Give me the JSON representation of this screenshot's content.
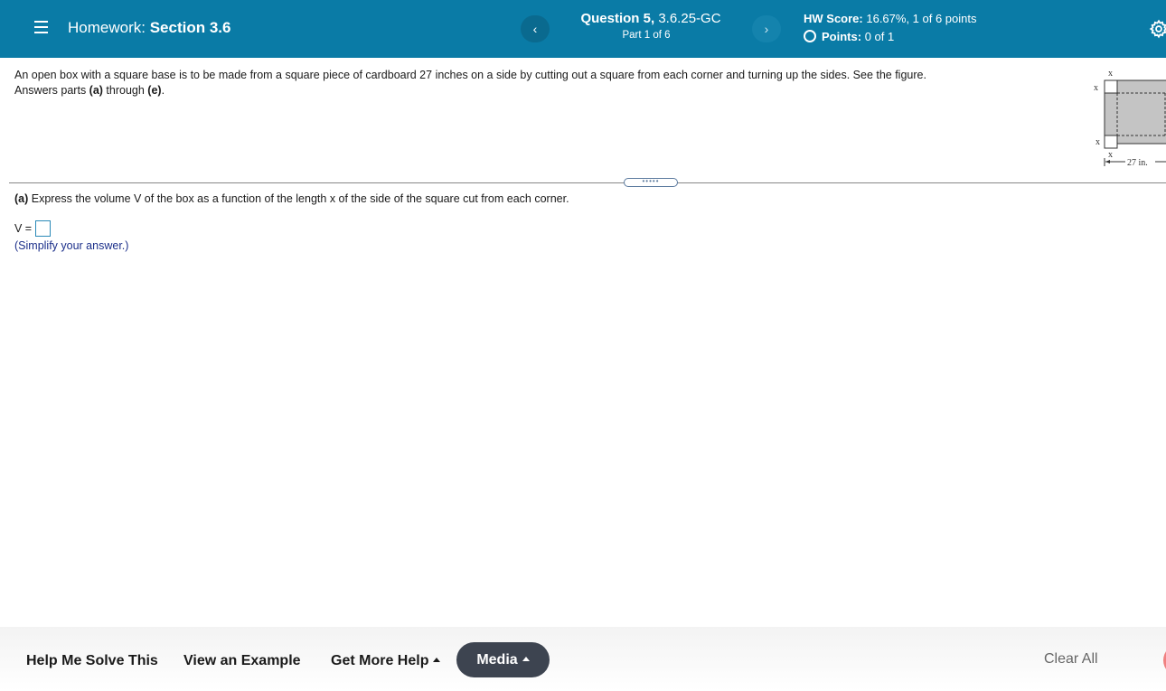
{
  "header": {
    "homework_label": "Homework:",
    "section_title": "Section 3.6",
    "question_label": "Question 5,",
    "question_id": "3.6.25-GC",
    "part": "Part 1 of 6",
    "prev_glyph": "‹",
    "next_glyph": "›",
    "score_label": "HW Score:",
    "score_value": "16.67%, 1 of 6 points",
    "points_label": "Points:",
    "points_value": "0 of 1"
  },
  "problem": {
    "text_line1": "An open box with a square base is to be made from a square piece of cardboard 27 inches on a side by cutting out a square from each corner and turning up the sides. See the figure.",
    "text_line2_pre": "Answers parts ",
    "part_first": "(a)",
    "text_through": " through ",
    "part_last": "(e)",
    "text_end": "."
  },
  "figure": {
    "x_label": "x",
    "dimension_label": "27 in."
  },
  "splitter": {
    "glyph": "•••••"
  },
  "part_a": {
    "label": "(a)",
    "prompt": " Express the volume V of the box as a function of the length x of the side of the square cut from each corner.",
    "answer_prefix": "V =",
    "hint": "(Simplify your answer.)"
  },
  "footer": {
    "help_solve": "Help Me Solve This",
    "view_example": "View an Example",
    "more_help": "Get More Help",
    "media": "Media",
    "clear_all": "Clear All"
  },
  "colors": {
    "header_bg": "#0a7ba6",
    "answer_border": "#2a8ab8",
    "hint_text": "#1b2f8a",
    "media_bg": "#3d4450"
  }
}
